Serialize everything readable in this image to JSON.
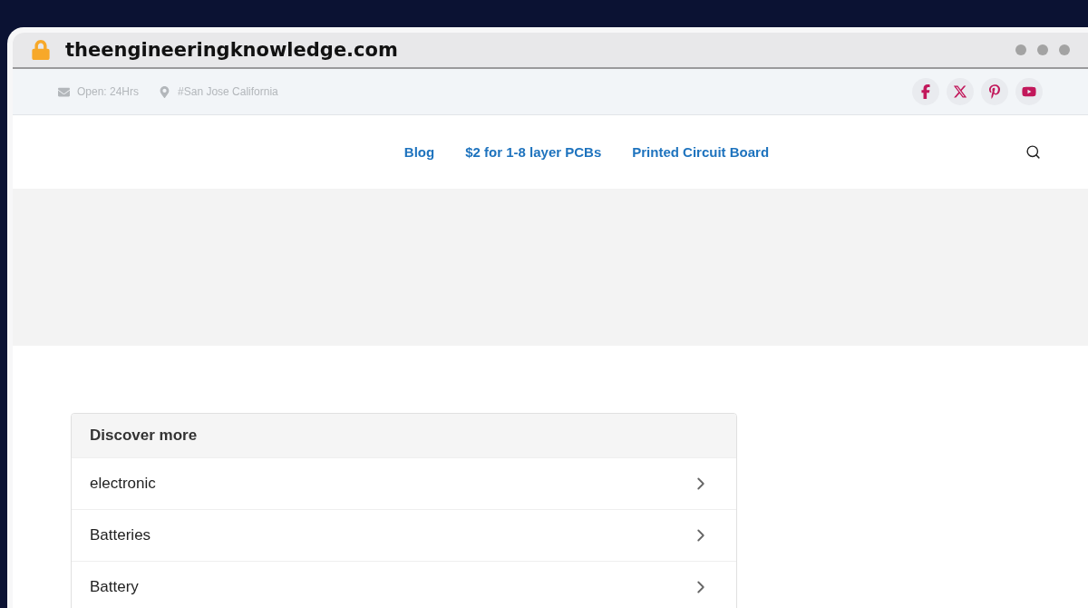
{
  "address_bar": {
    "url": "theengineeringknowledge.com"
  },
  "top_bar": {
    "items": [
      {
        "kind": "mail",
        "text": "Open: 24Hrs"
      },
      {
        "kind": "location",
        "text": "#San Jose California"
      }
    ],
    "social": [
      {
        "kind": "facebook"
      },
      {
        "kind": "x"
      },
      {
        "kind": "pinterest"
      },
      {
        "kind": "youtube"
      }
    ]
  },
  "nav": {
    "links": [
      "Blog",
      "$2 for 1-8 layer PCBs",
      "Printed Circuit Board"
    ]
  },
  "discover": {
    "title": "Discover more",
    "items": [
      "electronic",
      "Batteries",
      "Battery"
    ]
  }
}
